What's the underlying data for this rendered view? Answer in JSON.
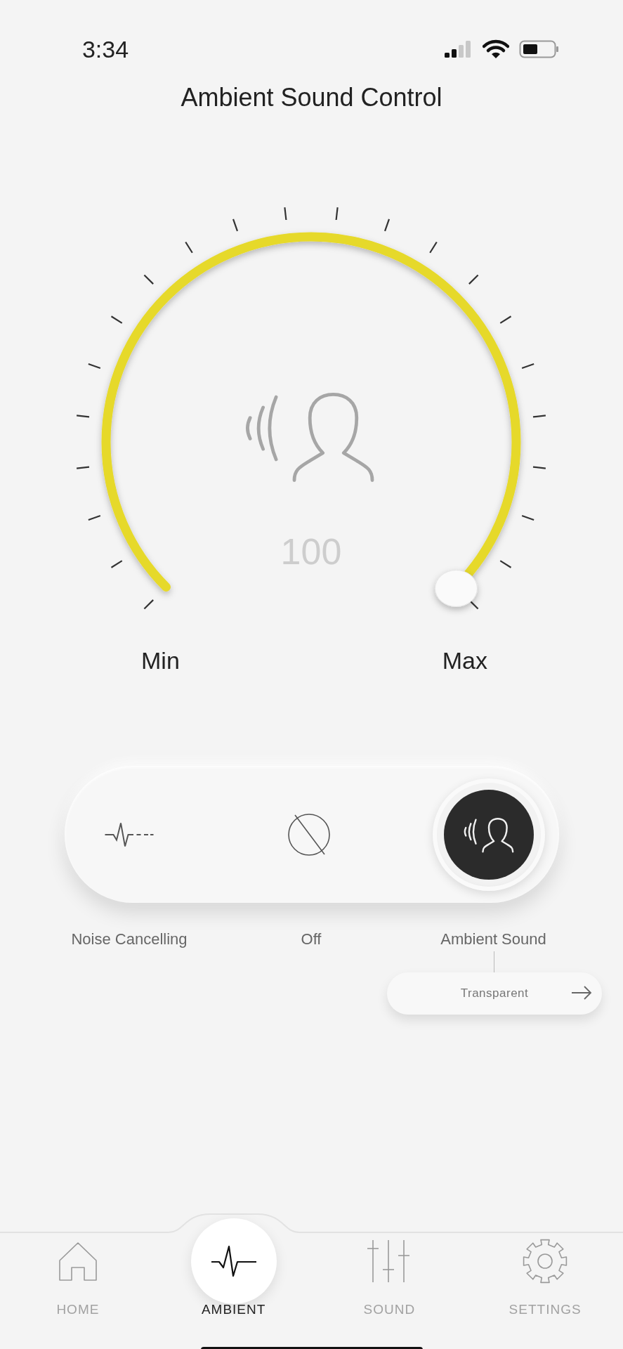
{
  "status_bar": {
    "time": "3:34"
  },
  "title": "Ambient Sound Control",
  "dial": {
    "value": "100",
    "min_label": "Min",
    "max_label": "Max"
  },
  "modes": [
    {
      "label": "Noise Cancelling",
      "kind": "noise",
      "selected": false
    },
    {
      "label": "Off",
      "kind": "off",
      "selected": false
    },
    {
      "label": "Ambient Sound",
      "kind": "ambient",
      "selected": true
    }
  ],
  "submode": {
    "label": "Transparent"
  },
  "tabs": [
    {
      "label": "HOME",
      "kind": "home",
      "selected": false
    },
    {
      "label": "AMBIENT",
      "kind": "ambient",
      "selected": true
    },
    {
      "label": "SOUND",
      "kind": "sound",
      "selected": false
    },
    {
      "label": "SETTINGS",
      "kind": "settings",
      "selected": false
    }
  ]
}
